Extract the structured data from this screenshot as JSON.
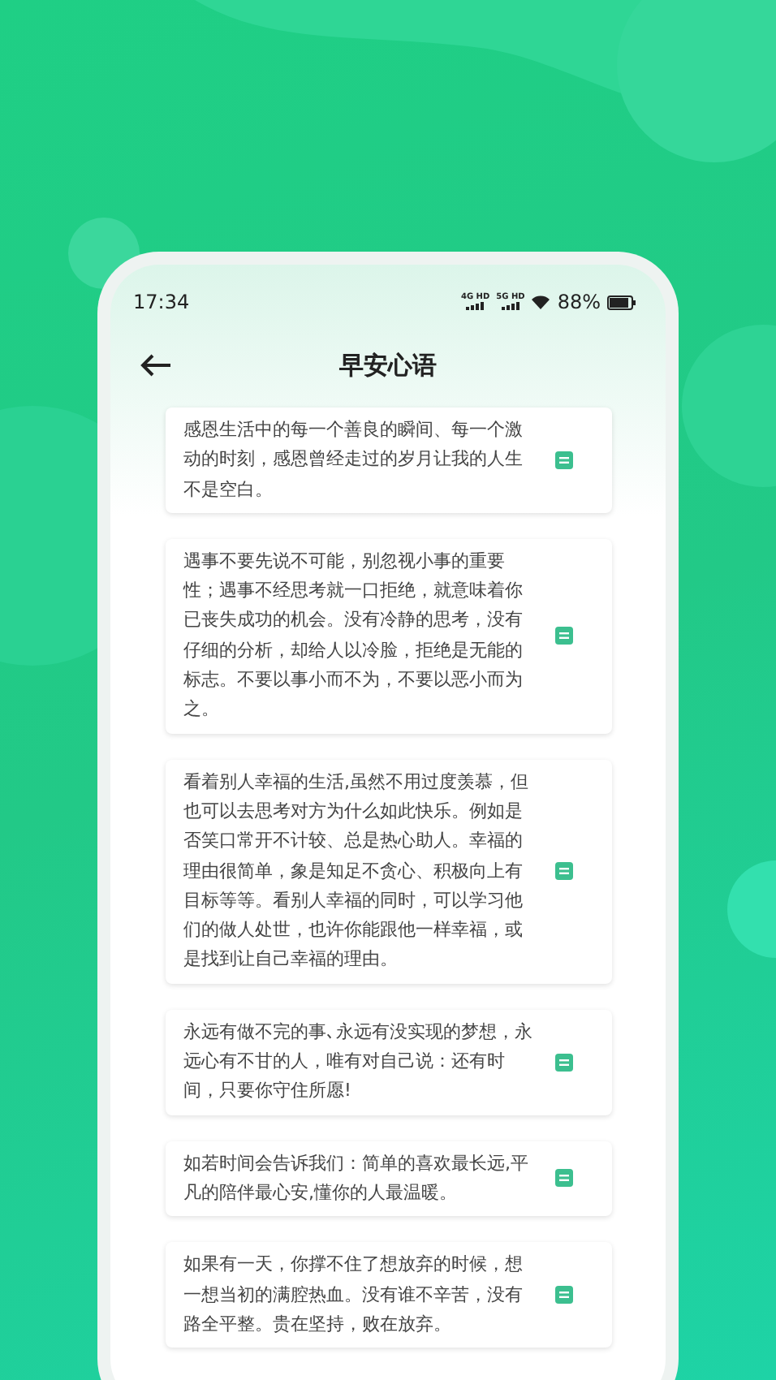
{
  "status_bar": {
    "time": "17:34",
    "network_labels": [
      "4G HD",
      "5G HD"
    ],
    "battery_text": "88%"
  },
  "header": {
    "title": "早安心语"
  },
  "quotes": [
    {
      "text": "感恩生活中的每一个善良的瞬间、每一个激动的时刻，感恩曾经走过的岁月让我的人生不是空白。"
    },
    {
      "text": "遇事不要先说不可能，别忽视小事的重要性；遇事不经思考就一口拒绝，就意味着你已丧失成功的机会。没有冷静的思考，没有仔细的分析，却给人以冷脸，拒绝是无能的标志。不要以事小而不为，不要以恶小而为之。"
    },
    {
      "text": "看着别人幸福的生活,虽然不用过度羡慕，但也可以去思考对方为什么如此快乐。例如是否笑口常开不计较、总是热心助人。幸福的理由很简单，象是知足不贪心、积极向上有目标等等。看别人幸福的同时，可以学习他们的做人处世，也许你能跟他一样幸福，或是找到让自己幸福的理由。"
    },
    {
      "text": "永远有做不完的事､永远有没实现的梦想，永远心有不甘的人，唯有对自己说：还有时间，只要你守住所愿!"
    },
    {
      "text": "如若时间会告诉我们：简单的喜欢最长远,平凡的陪伴最心安,懂你的人最温暖。"
    },
    {
      "text": "如果有一天，你撑不住了想放弃的时候，想一想当初的满腔热血。没有谁不辛苦，没有路全平整。贵在坚持，败在放弃。"
    }
  ]
}
